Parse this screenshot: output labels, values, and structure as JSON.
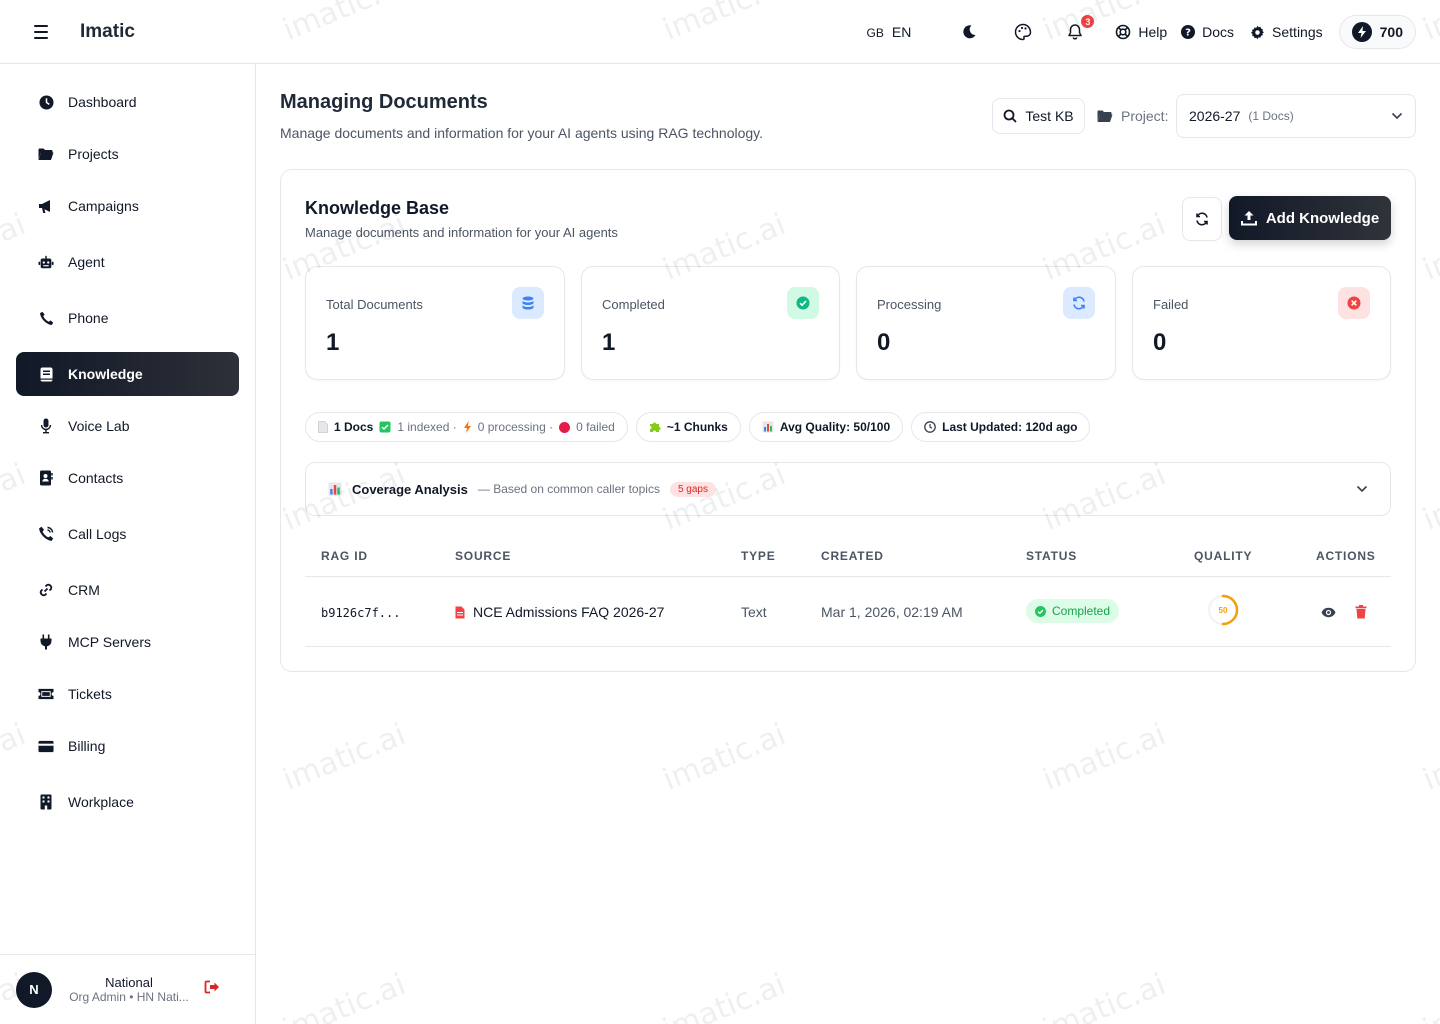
{
  "app": {
    "brand": "Imatic"
  },
  "topbar": {
    "lang_flag": "GB",
    "lang_code": "EN",
    "notifications_count": "3",
    "help_label": "Help",
    "docs_label": "Docs",
    "settings_label": "Settings",
    "credits": "700"
  },
  "sidebar": {
    "items": [
      {
        "label": "Dashboard",
        "icon": "dashboard-icon"
      },
      {
        "label": "Projects",
        "icon": "folder-icon"
      },
      {
        "label": "Campaigns",
        "icon": "megaphone-icon"
      },
      {
        "label": "Agent",
        "icon": "robot-icon"
      },
      {
        "label": "Phone",
        "icon": "phone-icon"
      },
      {
        "label": "Knowledge",
        "icon": "book-icon",
        "active": true
      },
      {
        "label": "Voice Lab",
        "icon": "microphone-icon"
      },
      {
        "label": "Contacts",
        "icon": "contacts-icon"
      },
      {
        "label": "Call Logs",
        "icon": "call-log-icon"
      },
      {
        "label": "CRM",
        "icon": "link-icon"
      },
      {
        "label": "MCP Servers",
        "icon": "plug-icon"
      },
      {
        "label": "Tickets",
        "icon": "ticket-icon"
      },
      {
        "label": "Billing",
        "icon": "credit-card-icon"
      },
      {
        "label": "Workplace",
        "icon": "building-icon"
      }
    ],
    "user": {
      "initial": "N",
      "name": "National",
      "role": "Org Admin • HN Nati..."
    }
  },
  "header": {
    "title": "Managing Documents",
    "subtitle": "Manage documents and information for your AI agents using RAG technology.",
    "test_kb_label": "Test KB",
    "project_label": "Project:",
    "project_value": "2026-27",
    "project_count": "(1 Docs)"
  },
  "kb": {
    "title": "Knowledge Base",
    "subtitle": "Manage documents and information for your AI agents",
    "add_label": "Add Knowledge",
    "stats": [
      {
        "label": "Total Documents",
        "value": "1",
        "color": "#3b82f6",
        "bg": "#dbeafe",
        "icon": "database-icon"
      },
      {
        "label": "Completed",
        "value": "1",
        "color": "#10b981",
        "bg": "#d1fae5",
        "icon": "check-circle-icon"
      },
      {
        "label": "Processing",
        "value": "0",
        "color": "#3b82f6",
        "bg": "#dbeafe",
        "icon": "sync-icon"
      },
      {
        "label": "Failed",
        "value": "0",
        "color": "#ef4444",
        "bg": "#fee2e2",
        "icon": "x-circle-icon"
      }
    ],
    "chips": {
      "docs": "1 Docs",
      "indexed": "1 indexed ·",
      "processing": "0 processing ·",
      "failed": "0 failed",
      "chunks": "~1 Chunks",
      "quality": "Avg Quality: 50/100",
      "updated": "Last Updated: 120d ago"
    },
    "coverage": {
      "title": "Coverage Analysis",
      "subtitle": "— Based on common caller topics",
      "gaps": "5 gaps"
    },
    "table": {
      "headers": [
        "RAG ID",
        "SOURCE",
        "TYPE",
        "CREATED",
        "STATUS",
        "QUALITY",
        "ACTIONS"
      ],
      "rows": [
        {
          "rag_id": "b9126c7f...",
          "source": "NCE Admissions FAQ 2026-27",
          "type": "Text",
          "created": "Mar 1, 2026, 02:19 AM",
          "status": "Completed",
          "quality": "50",
          "quality_fraction": 0.5
        }
      ]
    }
  },
  "watermark": "imatic.ai"
}
